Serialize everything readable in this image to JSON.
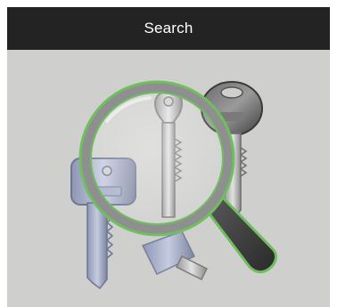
{
  "header": {
    "title": "Search"
  },
  "illustration": {
    "icon": "search-keys-icon",
    "colors": {
      "background": "#cfcfce",
      "header": "#232323",
      "lens_ring": "#6fbf5e",
      "handle": "#4a4a4a"
    }
  }
}
